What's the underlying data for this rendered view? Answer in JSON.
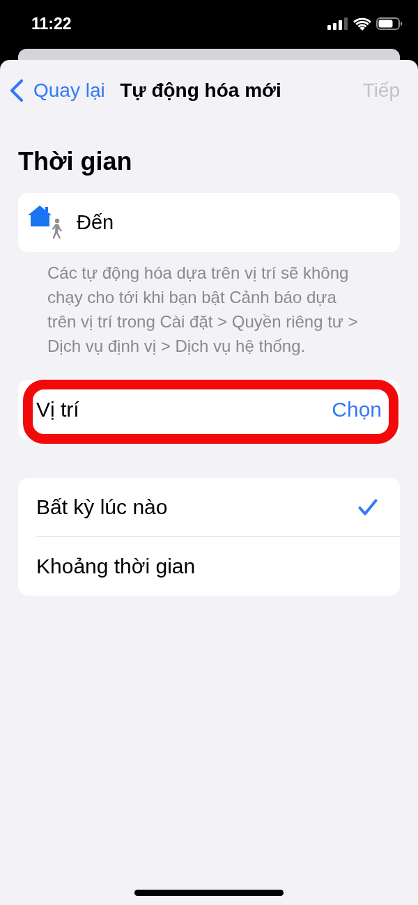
{
  "status_bar": {
    "time": "11:22"
  },
  "nav_bar": {
    "back": "Quay lại",
    "title": "Tự động hóa mới",
    "next": {
      "label": "Tiếp",
      "disabled": true
    }
  },
  "heading": "Thời gian",
  "trigger": {
    "label": "Đến"
  },
  "footnote": "Các tự động hóa dựa trên vị trí sẽ không chạy cho tới khi bạn bật Cảnh báo dựa trên vị trí trong Cài đặt > Quyền riêng tư > Dịch vụ định vị > Dịch vụ hệ thống.",
  "location": {
    "label": "Vị trí",
    "action": "Chọn",
    "highlighted": true
  },
  "options": [
    {
      "label": "Bất kỳ lúc nào",
      "selected": true
    },
    {
      "label": "Khoảng thời gian",
      "selected": false
    }
  ]
}
